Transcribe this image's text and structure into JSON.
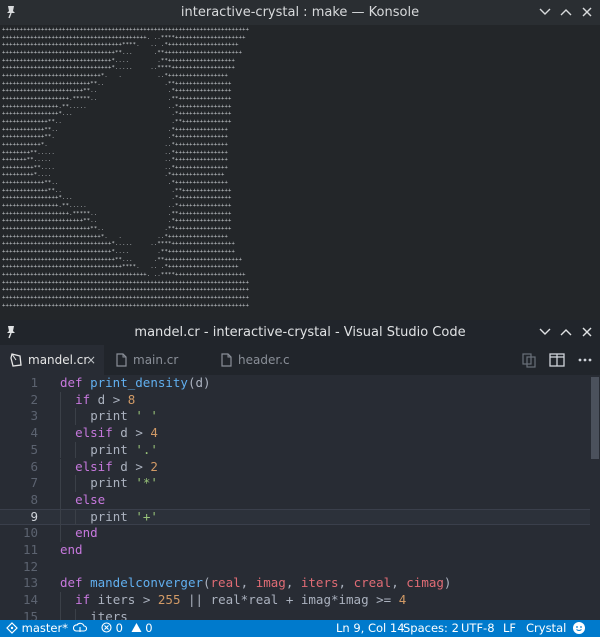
{
  "konsole": {
    "title": "interactive-crystal : make — Konsole",
    "output_lines": [
      "++++++++++++++++++++++++++++++++++++++++++++++++++++++++++++++++++++++",
      "+++++++++++++++++++++++++++++++++++++++++. ..****++++++++++++++++++++",
      "++++++++++++++++++++++++++++++++++****.   .. .*++++++++++++++++++++",
      "++++++++++++++++++++++++++++++++**...      .**++++++++++++++++++++++",
      "+++++++++++++++++++++++++++++++*....        .**+++++++++++++++++++",
      "+++++++++++++++++++++++++++++++*.....     ..****++++++++++++++++++",
      "++++++++++++++++++++++++++++*.   .          ..*+++++++++++++++++",
      "+++++++++++++++++++++++++**..                 .**++++++++++++++++",
      "+++++++++++++++++++++++**..                    .*++++++++++++++++",
      "+++++++++++++++++++.*****..                    .**+++++++++++++++",
      "++++++++++++++++.**.....                       ..*+++++++++++++++",
      "++++++++++++++++*...                            .*+++++++++++++++",
      "+++++++++++++**..                               .**++++++++++++++",
      "++++++++++++**..                               .*+++++++++++++++",
      "++++++++++++**.                                .*+++++++++++++++",
      "+++++++++++*.                                 ..*+++++++++++++++",
      "++++++++**.....                               ..*+++++++++++++++",
      "+++++++**.....                                ..*+++++++++++++++",
      "+++++++++**....                               ..*+++++++++++++++",
      "+++++++++*....                                .*+++++++++++++++",
      "++++++++++++**..                               .*+++++++++++++++",
      "+++++++++++++**..                               .**++++++++++++++",
      "++++++++++++++++*...                            .*+++++++++++++++",
      "++++++++++++++++.**.....                       ..*+++++++++++++++",
      "+++++++++++++++++++.*****..                    .**+++++++++++++++",
      "+++++++++++++++++++++++**..                    .*++++++++++++++++",
      "+++++++++++++++++++++++++**..                 .**++++++++++++++++",
      "++++++++++++++++++++++++++++*.   .          ..*+++++++++++++++++",
      "+++++++++++++++++++++++++++++++*.....     ..****++++++++++++++++++",
      "+++++++++++++++++++++++++++++++*....        .**+++++++++++++++++++",
      "++++++++++++++++++++++++++++++++**...      .**++++++++++++++++++++++",
      "++++++++++++++++++++++++++++++++++****.   .. .*++++++++++++++++++++",
      "+++++++++++++++++++++++++++++++++++++++++. ..****++++++++++++++++++++",
      "++++++++++++++++++++++++++++++++++++++++++++++++++++++++++++++++++++++",
      "++++++++++++++++++++++++++++++++++++++++++++++++++++++++++++++++++++++",
      "++++++++++++++++++++++++++++++++++++++++++++++++++++++++++++++++++++++",
      "++++++++++++++++++++++++++++++++++++++++++++++++++++++++++++++++++++++"
    ]
  },
  "vscode": {
    "title": "mandel.cr - interactive-crystal - Visual Studio Code",
    "tabs": [
      {
        "label": "mandel.cr",
        "active": true,
        "close": "×",
        "icon": "crystal-file-icon"
      },
      {
        "label": "main.cr",
        "active": false,
        "icon": "file-icon"
      },
      {
        "label": "header.c",
        "active": false,
        "icon": "file-icon"
      }
    ],
    "lines": [
      {
        "n": "1",
        "indent": 0,
        "tokens": [
          [
            "kw",
            "def"
          ],
          [
            "t",
            " "
          ],
          [
            "fn",
            "print_density"
          ],
          [
            "t",
            "(d)"
          ]
        ]
      },
      {
        "n": "2",
        "indent": 1,
        "tokens": [
          [
            "kw",
            "if"
          ],
          [
            "t",
            " d "
          ],
          [
            "t",
            "> "
          ],
          [
            "num",
            "8"
          ]
        ]
      },
      {
        "n": "3",
        "indent": 2,
        "tokens": [
          [
            "t",
            "print "
          ],
          [
            "str",
            "' '"
          ]
        ]
      },
      {
        "n": "4",
        "indent": 1,
        "tokens": [
          [
            "kw",
            "elsif"
          ],
          [
            "t",
            " d "
          ],
          [
            "t",
            "> "
          ],
          [
            "num",
            "4"
          ]
        ]
      },
      {
        "n": "5",
        "indent": 2,
        "tokens": [
          [
            "t",
            "print "
          ],
          [
            "str",
            "'.'"
          ]
        ]
      },
      {
        "n": "6",
        "indent": 1,
        "tokens": [
          [
            "kw",
            "elsif"
          ],
          [
            "t",
            " d "
          ],
          [
            "t",
            "> "
          ],
          [
            "num",
            "2"
          ]
        ]
      },
      {
        "n": "7",
        "indent": 2,
        "tokens": [
          [
            "t",
            "print "
          ],
          [
            "str",
            "'*'"
          ]
        ]
      },
      {
        "n": "8",
        "indent": 1,
        "tokens": [
          [
            "kw",
            "else"
          ]
        ]
      },
      {
        "n": "9",
        "indent": 2,
        "tokens": [
          [
            "t",
            "print "
          ],
          [
            "str",
            "'+'"
          ]
        ],
        "current": true
      },
      {
        "n": "10",
        "indent": 1,
        "tokens": [
          [
            "kw",
            "end"
          ]
        ]
      },
      {
        "n": "11",
        "indent": 0,
        "tokens": [
          [
            "kw",
            "end"
          ]
        ]
      },
      {
        "n": "12",
        "indent": 0,
        "tokens": []
      },
      {
        "n": "13",
        "indent": 0,
        "tokens": [
          [
            "kw",
            "def"
          ],
          [
            "t",
            " "
          ],
          [
            "fn",
            "mandelconverger"
          ],
          [
            "t",
            "("
          ],
          [
            "var",
            "real"
          ],
          [
            "t",
            ", "
          ],
          [
            "var",
            "imag"
          ],
          [
            "t",
            ", "
          ],
          [
            "var",
            "iters"
          ],
          [
            "t",
            ", "
          ],
          [
            "var",
            "creal"
          ],
          [
            "t",
            ", "
          ],
          [
            "var",
            "cimag"
          ],
          [
            "t",
            ")"
          ]
        ]
      },
      {
        "n": "14",
        "indent": 1,
        "tokens": [
          [
            "kw",
            "if"
          ],
          [
            "t",
            " iters > "
          ],
          [
            "num",
            "255"
          ],
          [
            "t",
            " || real*real + imag*imag >= "
          ],
          [
            "num",
            "4"
          ]
        ]
      },
      {
        "n": "15",
        "indent": 2,
        "tokens": [
          [
            "t",
            "iters"
          ]
        ]
      }
    ]
  },
  "statusbar": {
    "branch": "master*",
    "errors": "0",
    "warnings": "0",
    "position": "Ln 9, Col 14",
    "spaces": "Spaces: 2",
    "encoding": "UTF-8",
    "eol": "LF",
    "language": "Crystal"
  },
  "colors": {
    "statusbar": "#007acc",
    "keyword": "#c678dd",
    "function": "#61afef",
    "string": "#98c379",
    "number": "#d19a66",
    "param": "#e06c75"
  }
}
